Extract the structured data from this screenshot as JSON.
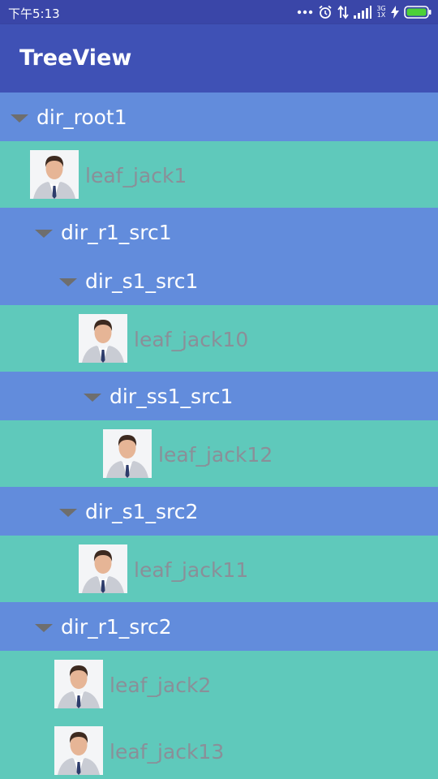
{
  "status_bar": {
    "time": "下午5:13",
    "network_label": "3G 1X",
    "icons": [
      "more-dots-icon",
      "alarm-clock-icon",
      "data-transfer-icon",
      "signal-bars-icon",
      "network-type-icon",
      "charging-bolt-icon",
      "battery-icon"
    ],
    "battery_color": "#4cd137"
  },
  "app_bar": {
    "title": "TreeView",
    "color": "#3f51b5"
  },
  "colors": {
    "directory_row": "#628cdc",
    "leaf_row": "#5fc9bb",
    "caret": "#6e6e6e",
    "directory_text": "#ffffff",
    "leaf_text": "#8a8f98"
  },
  "tree": [
    {
      "type": "directory",
      "label": "dir_root1",
      "depth": 0,
      "expanded": true
    },
    {
      "type": "leaf",
      "label": "leaf_jack1",
      "depth": 1,
      "icon": "person-avatar-icon"
    },
    {
      "type": "directory",
      "label": "dir_r1_src1",
      "depth": 1,
      "expanded": true
    },
    {
      "type": "directory",
      "label": "dir_s1_src1",
      "depth": 2,
      "expanded": true
    },
    {
      "type": "leaf",
      "label": "leaf_jack10",
      "depth": 3,
      "icon": "person-avatar-icon"
    },
    {
      "type": "directory",
      "label": "dir_ss1_src1",
      "depth": 3,
      "expanded": true
    },
    {
      "type": "leaf",
      "label": "leaf_jack12",
      "depth": 4,
      "icon": "person-avatar-icon"
    },
    {
      "type": "directory",
      "label": "dir_s1_src2",
      "depth": 2,
      "expanded": true
    },
    {
      "type": "leaf",
      "label": "leaf_jack11",
      "depth": 3,
      "icon": "person-avatar-icon"
    },
    {
      "type": "directory",
      "label": "dir_r1_src2",
      "depth": 1,
      "expanded": true
    },
    {
      "type": "leaf",
      "label": "leaf_jack2",
      "depth": 2,
      "icon": "person-avatar-icon"
    },
    {
      "type": "leaf",
      "label": "leaf_jack13",
      "depth": 2,
      "icon": "person-avatar-icon"
    }
  ]
}
